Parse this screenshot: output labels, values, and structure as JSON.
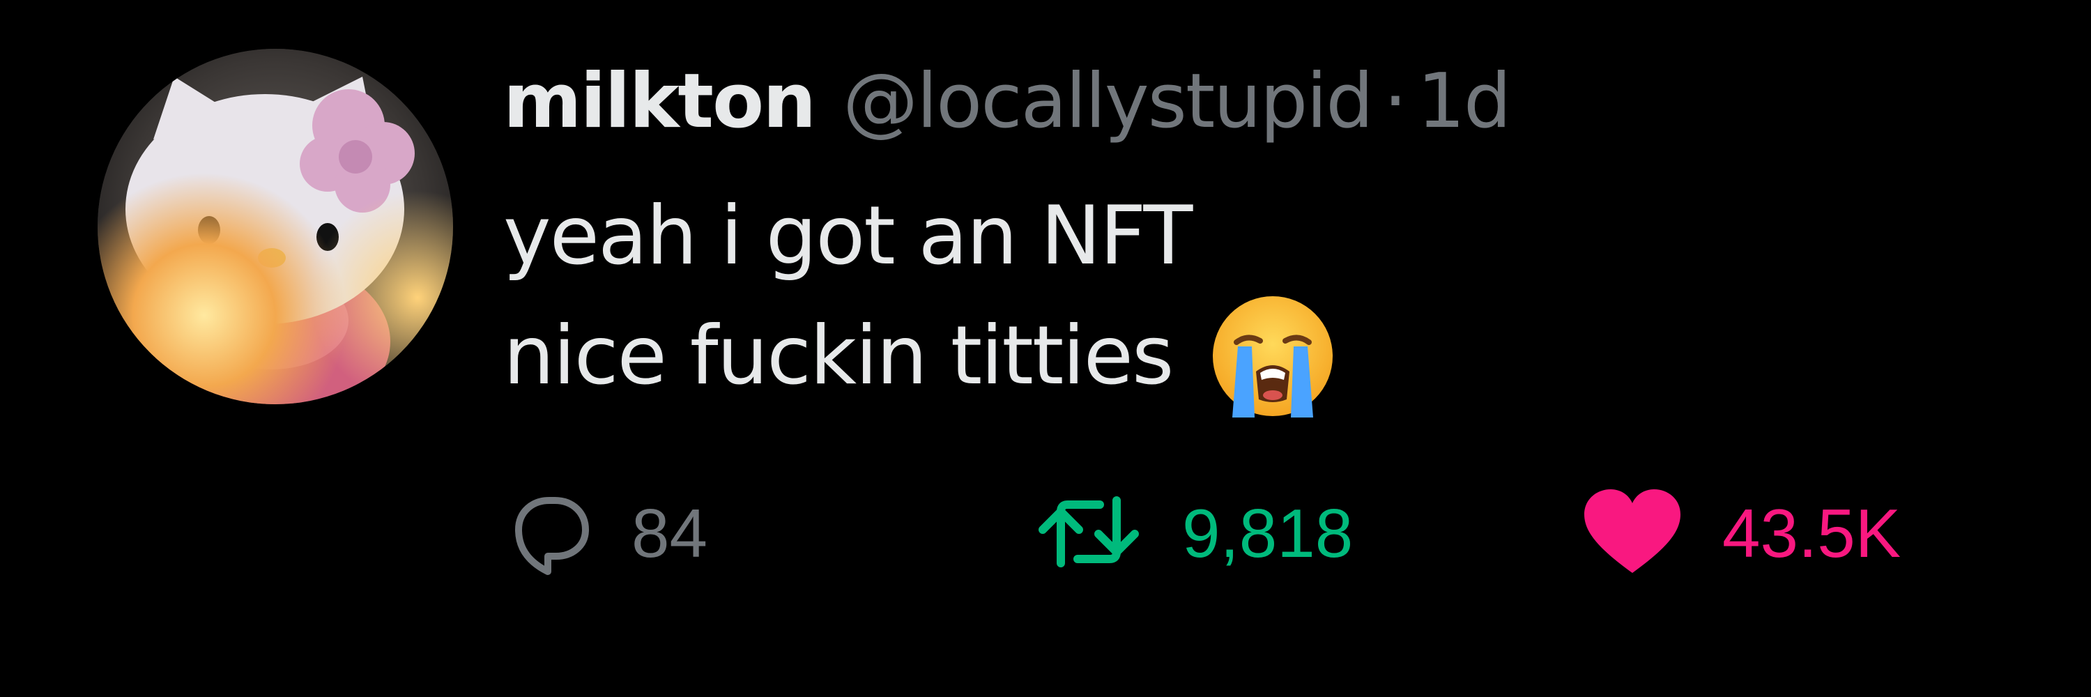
{
  "tweet": {
    "display_name": "milkton",
    "handle": "@locallystupid",
    "separator": "·",
    "time": "1d",
    "lines": [
      "yeah i got an NFT",
      "nice fuckin titties"
    ],
    "emoji": "loudly-crying-face"
  },
  "actions": {
    "reply": {
      "icon": "reply-bubble-icon",
      "count": "84",
      "color": "#71767b"
    },
    "retweet": {
      "icon": "retweet-icon",
      "count": "9,818",
      "color": "#00ba7c",
      "active": true
    },
    "like": {
      "icon": "heart-icon",
      "count": "43.5K",
      "color": "#f91880",
      "active": true
    }
  }
}
